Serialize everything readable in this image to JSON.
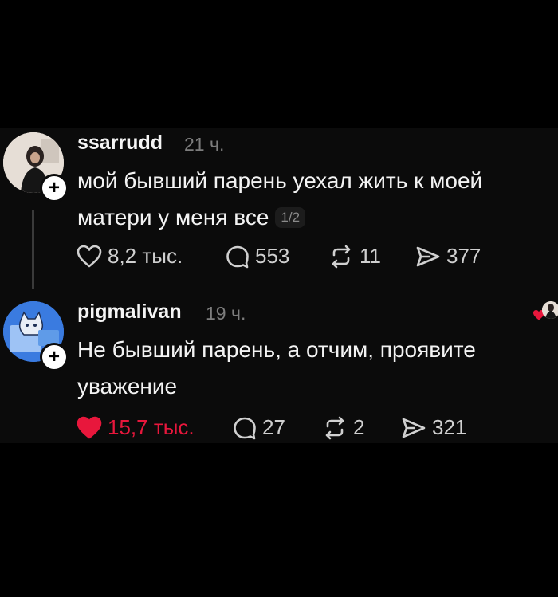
{
  "posts": [
    {
      "username": "ssarrudd",
      "time": "21 ч.",
      "text_line1": "мой бывший парень уехал жить к моей",
      "text_line2": "матери у меня все",
      "page_indicator": "1/2",
      "likes": "8,2 тыс.",
      "replies": "553",
      "reposts": "11",
      "shares": "377",
      "liked": false
    },
    {
      "username": "pigmalivan",
      "time": "19 ч.",
      "text_line1": "Не бывший парень, а отчим, проявите",
      "text_line2": "уважение",
      "likes": "15,7 тыс.",
      "replies": "27",
      "reposts": "2",
      "shares": "321",
      "liked": true
    }
  ],
  "colors": {
    "background": "#000000",
    "panel": "#0b0b0b",
    "like_red": "#e8173c",
    "muted": "#7d7d7d"
  },
  "icons": [
    "plus-icon",
    "heart-icon",
    "comment-icon",
    "repost-icon",
    "share-icon"
  ]
}
